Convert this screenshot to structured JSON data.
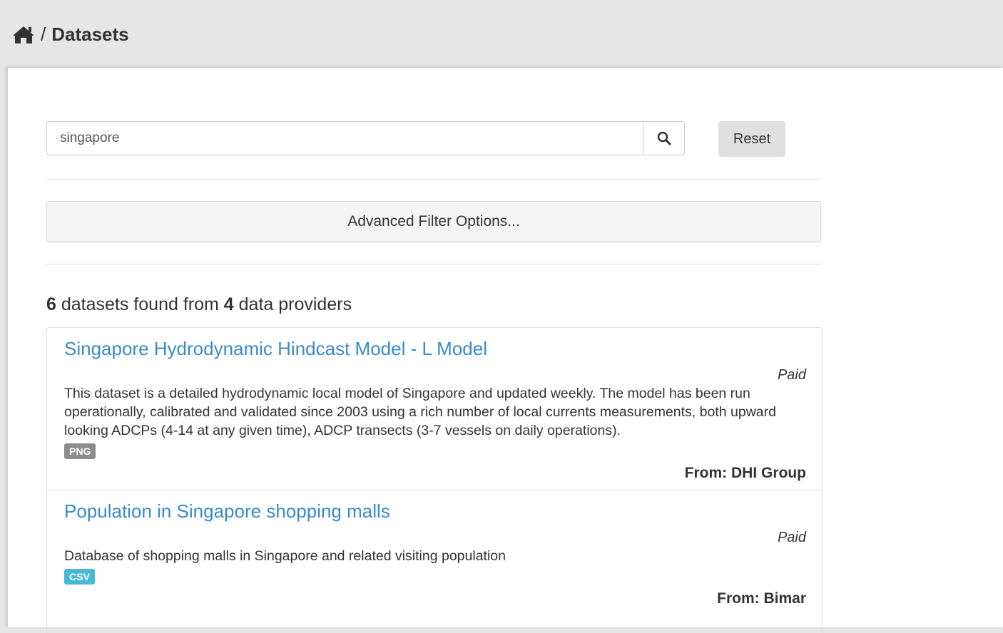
{
  "breadcrumb": {
    "home_icon": "home-icon",
    "separator": "/",
    "current": "Datasets"
  },
  "search": {
    "value": "singapore",
    "search_icon": "search-icon",
    "reset_label": "Reset"
  },
  "advanced_filter_label": "Advanced Filter Options...",
  "summary": {
    "dataset_count": "6",
    "text_middle": "datasets found from",
    "provider_count": "4",
    "text_end": "data providers"
  },
  "results": [
    {
      "title": "Singapore Hydrodynamic Hindcast Model - L Model",
      "price": "Paid",
      "description": "This dataset is a detailed hydrodynamic local model of Singapore and updated weekly. The model has been run operationally, calibrated and validated since 2003 using a rich number of local currents measurements, both upward looking ADCPs (4-14 at any given time), ADCP transects (3-7 vessels on daily operations).",
      "format": "PNG",
      "format_color": "#8c8c8c",
      "provider": "From: DHI Group"
    },
    {
      "title": "Population in Singapore shopping malls",
      "price": "Paid",
      "description": "Database of shopping malls in Singapore and related visiting population",
      "format": "CSV",
      "format_color": "#4bb8d6",
      "provider": "From: Bimar"
    }
  ],
  "colors": {
    "link": "#3a8ac8",
    "background": "#e6e6e6"
  }
}
